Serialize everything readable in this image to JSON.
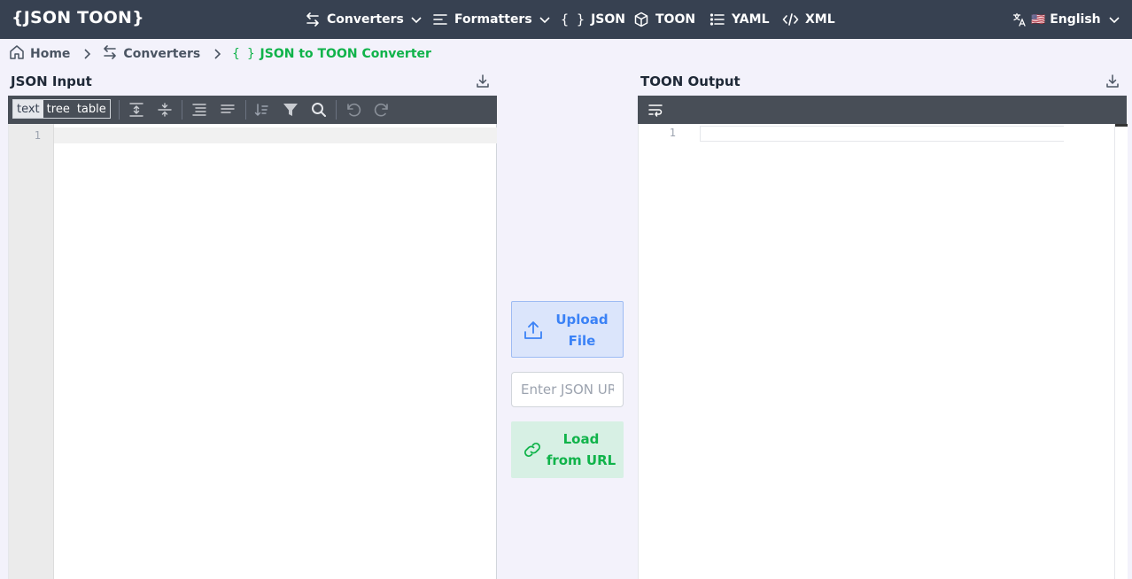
{
  "header": {
    "logo": "{JSON TOON}",
    "nav": [
      {
        "label": "Converters",
        "icon": "arrows-swap-icon",
        "dropdown": true
      },
      {
        "label": "Formatters",
        "icon": "align-left-icon",
        "dropdown": true
      },
      {
        "label": "JSON",
        "icon": "braces-icon"
      },
      {
        "label": "TOON",
        "icon": "cube-icon"
      },
      {
        "label": "YAML",
        "icon": "list-icon"
      },
      {
        "label": "XML",
        "icon": "code-icon"
      }
    ],
    "language": {
      "label": "English",
      "flag": "🇺🇸",
      "icon": "translate-icon"
    }
  },
  "breadcrumb": {
    "items": [
      {
        "label": "Home",
        "icon": "home-icon"
      },
      {
        "label": "Converters",
        "icon": "arrows-swap-icon"
      },
      {
        "label": "JSON to TOON Converter",
        "icon": "braces-icon"
      }
    ],
    "active_prefix": "{ }"
  },
  "left_panel": {
    "title": "JSON Input",
    "modes": [
      "text",
      "tree",
      "table"
    ],
    "active_mode": "text",
    "line_numbers": [
      "1"
    ]
  },
  "middle": {
    "upload_label_1": "Upload",
    "upload_label_2": "File",
    "url_placeholder": "Enter JSON URL",
    "load_label_1": "Load",
    "load_label_2": "from URL"
  },
  "right_panel": {
    "title": "TOON Output",
    "line_numbers": [
      "1"
    ]
  },
  "colors": {
    "header_bg": "#374151",
    "accent_green": "#10b34a",
    "accent_blue": "#3b82f6",
    "page_bg": "#f3f2fb",
    "toolbar_bg": "#484e57"
  }
}
